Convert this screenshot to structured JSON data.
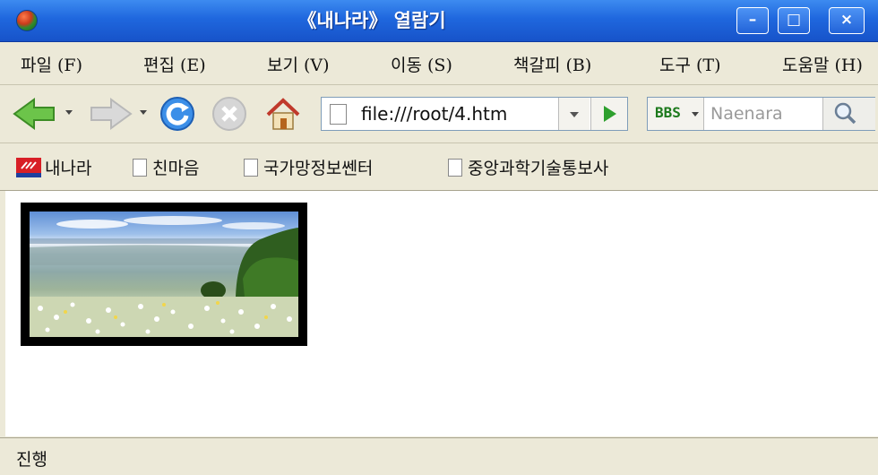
{
  "window": {
    "title": "《내나라》 열람기",
    "buttons": {
      "minimize": "–",
      "maximize": "□",
      "close": "×"
    }
  },
  "menu": [
    {
      "label": "파일",
      "key": "(F)"
    },
    {
      "label": "편집",
      "key": "(E)"
    },
    {
      "label": "보기",
      "key": "(V)"
    },
    {
      "label": "이동",
      "key": "(S)"
    },
    {
      "label": "책갈피",
      "key": "(B)"
    },
    {
      "label": "도구",
      "key": "(T)"
    },
    {
      "label": "도움말",
      "key": "(H)"
    }
  ],
  "toolbar": {
    "icons": [
      "back-arrow-icon",
      "forward-arrow-icon",
      "reload-icon",
      "stop-icon",
      "home-icon"
    ],
    "url": "file:///root/4.htm",
    "search_engine": "BBS",
    "search_placeholder": "Naenara"
  },
  "bookmarks": [
    {
      "label": "내나라",
      "icon": "naenara-logo-icon"
    },
    {
      "label": "친마음",
      "icon": "page-icon"
    },
    {
      "label": "국가망정보쎈터",
      "icon": "page-icon"
    },
    {
      "label": "중앙과학기술통보사",
      "icon": "page-icon"
    }
  ],
  "content": {
    "image": "landscape-photo-flower-field-with-sea"
  },
  "status": {
    "text": "진행"
  },
  "colors": {
    "titlebar": "#2563dc",
    "chrome": "#ece9d8",
    "go_arrow": "#2ea02e",
    "back_arrow": "#5dbb3a"
  }
}
